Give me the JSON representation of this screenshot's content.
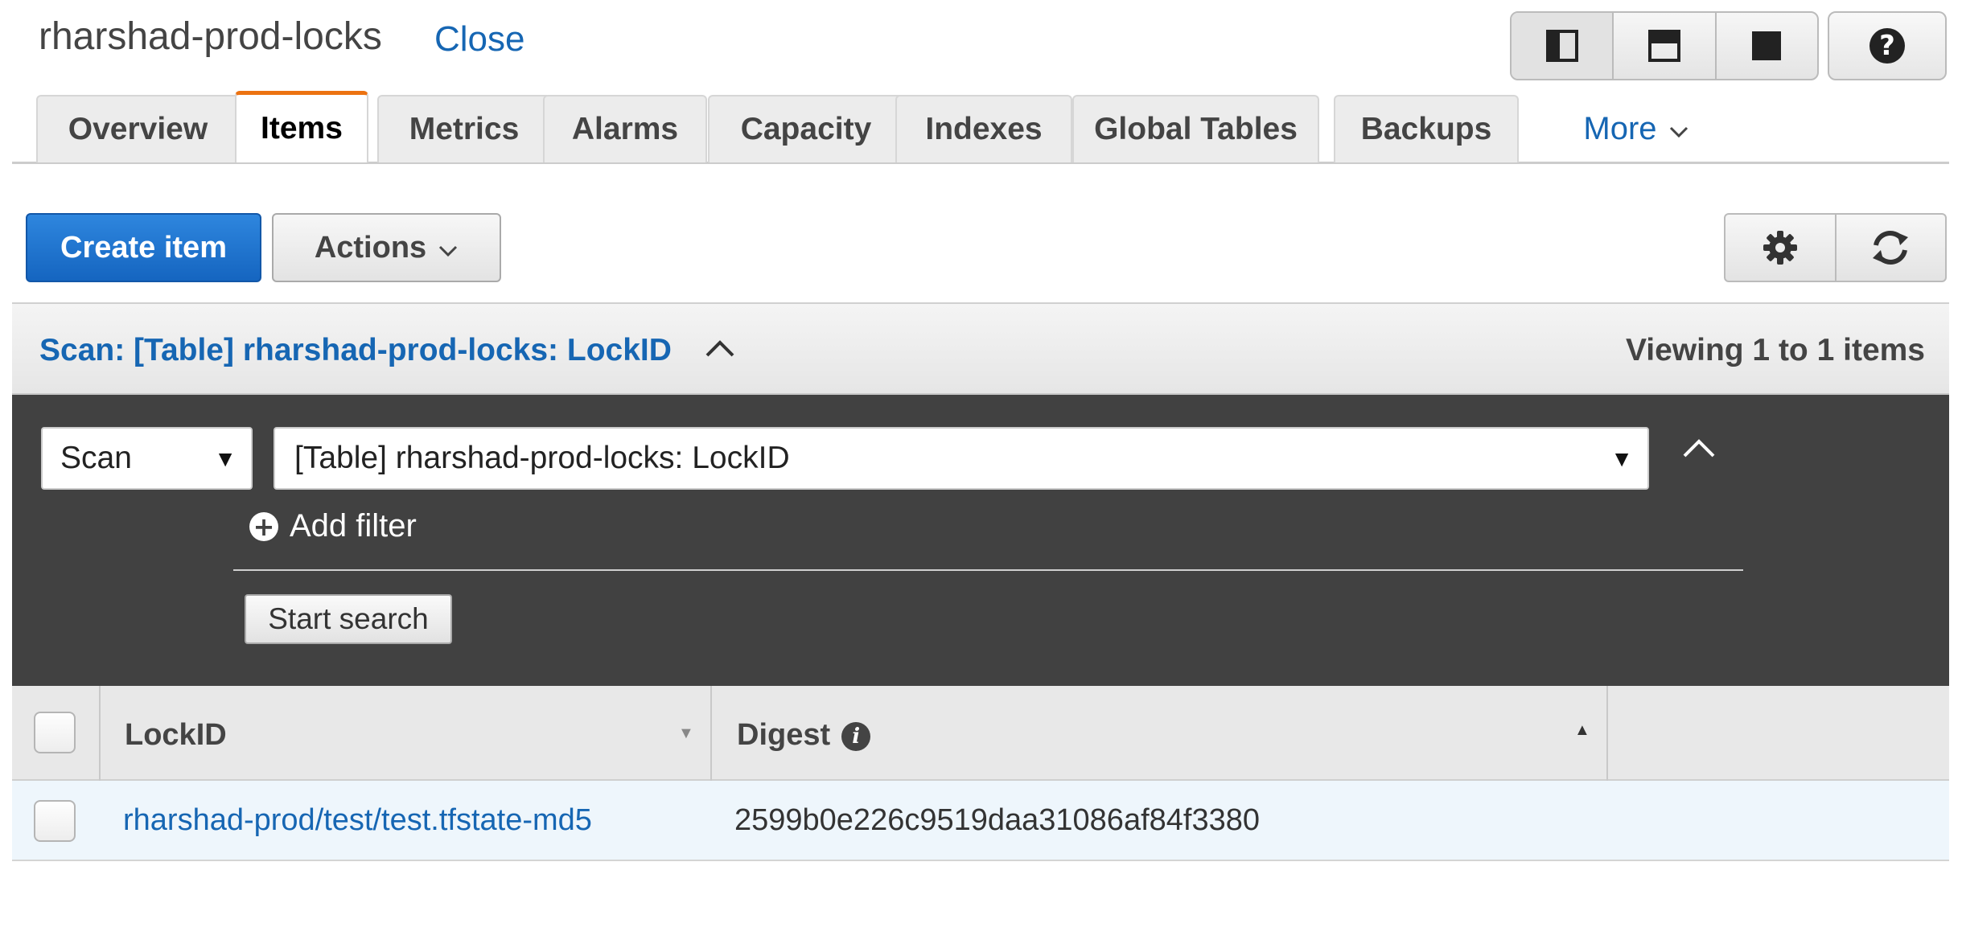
{
  "header": {
    "title": "rharshad-prod-locks",
    "close_label": "Close"
  },
  "tabs": [
    {
      "label": "Overview"
    },
    {
      "label": "Items",
      "active": true
    },
    {
      "label": "Metrics"
    },
    {
      "label": "Alarms"
    },
    {
      "label": "Capacity"
    },
    {
      "label": "Indexes"
    },
    {
      "label": "Global Tables"
    },
    {
      "label": "Backups"
    },
    {
      "label": "More"
    }
  ],
  "toolbar": {
    "create_label": "Create item",
    "actions_label": "Actions"
  },
  "scan": {
    "title": "Scan: [Table] rharshad-prod-locks: LockID",
    "viewing": "Viewing 1 to 1 items",
    "mode_value": "Scan",
    "target_value": "[Table] rharshad-prod-locks: LockID",
    "add_filter_label": "Add filter",
    "start_search_label": "Start search"
  },
  "table": {
    "columns": [
      "LockID",
      "Digest"
    ],
    "rows": [
      {
        "lockid": "rharshad-prod/test/test.tfstate-md5",
        "digest": "2599b0e226c9519daa31086af84f3380"
      }
    ]
  },
  "colors": {
    "accent": "#1666b3",
    "active_tab": "#ec7211",
    "primary_button": "#1565c0",
    "filter_panel": "#414141"
  }
}
